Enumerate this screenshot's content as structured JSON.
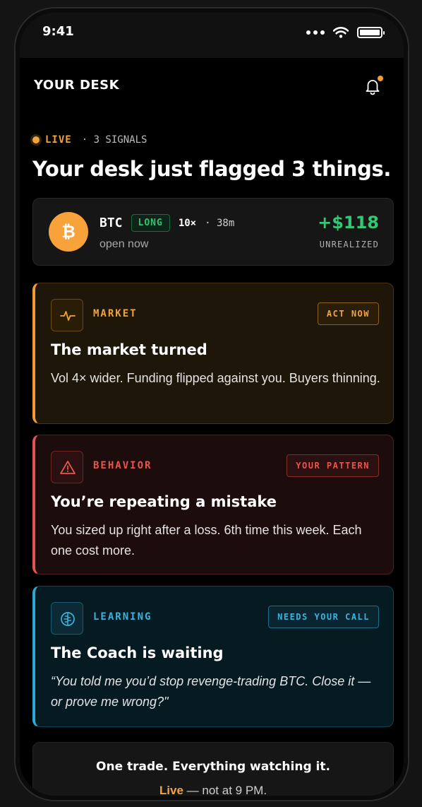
{
  "status_bar": {
    "time": "9:41"
  },
  "header": {
    "title": "YOUR DESK",
    "notification_icon": "bell-icon"
  },
  "live": {
    "label": "LIVE",
    "signals": "· 3 SIGNALS"
  },
  "headline": "Your desk just flagged 3 things.",
  "position": {
    "symbol": "BTC",
    "side": "LONG",
    "leverage": "10×",
    "duration": "· 38m",
    "status": "open now",
    "pnl": "+$118",
    "pnl_label": "UNREALIZED",
    "coin_icon": "bitcoin-icon"
  },
  "signals": [
    {
      "category": "MARKET",
      "tag": "ACT NOW",
      "title": "The market turned",
      "body": "Vol 4× wider. Funding flipped against you. Buyers thinning.",
      "icon": "pulse-icon",
      "color": "#f29b33"
    },
    {
      "category": "BEHAVIOR",
      "tag": "YOUR PATTERN",
      "title": "You’re repeating a mistake",
      "body": "You sized up right after a loss. 6th time this week. Each one cost more.",
      "icon": "warning-icon",
      "color": "#e25550"
    },
    {
      "category": "LEARNING",
      "tag": "NEEDS YOUR CALL",
      "title": "The Coach is waiting",
      "body": "“You told me you’d stop revenge-trading BTC. Close it — or prove me wrong?\"",
      "icon": "brain-icon",
      "color": "#2aa9d4"
    }
  ],
  "footer": {
    "line1": "One trade. Everything watching it.",
    "live_word": "Live",
    "line2_rest": " — not at 9 PM."
  }
}
